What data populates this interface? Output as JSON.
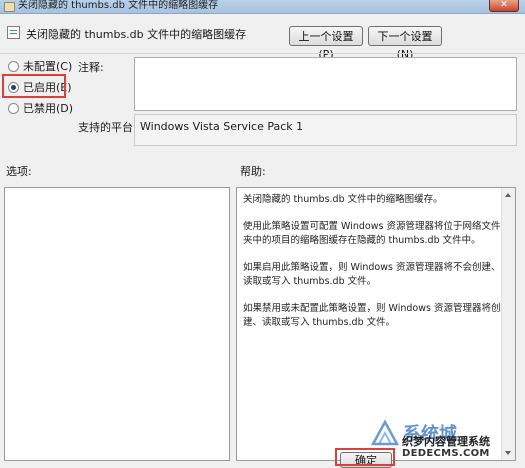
{
  "window": {
    "title": "关闭隐藏的 thumbs.db 文件中的缩略图缓存",
    "close_label": "✕"
  },
  "header": {
    "policy_name": "关闭隐藏的 thumbs.db 文件中的缩略图缓存",
    "prev_label": "上一个设置(P)",
    "next_label": "下一个设置(N)"
  },
  "state": {
    "options": [
      {
        "label": "未配置(C)",
        "selected": false
      },
      {
        "label": "已启用(E)",
        "selected": true
      },
      {
        "label": "已禁用(D)",
        "selected": false
      }
    ]
  },
  "comment": {
    "label": "注释:",
    "value": ""
  },
  "platform": {
    "label": "支持的平台:",
    "value": "Windows Vista Service Pack 1"
  },
  "options_pane": {
    "label": "选项:"
  },
  "help_pane": {
    "label": "帮助:",
    "paragraphs": [
      "关闭隐藏的 thumbs.db 文件中的缩略图缓存。",
      "使用此策略设置可配置 Windows 资源管理器将位于网络文件夹中的项目的缩略图缓存在隐藏的 thumbs.db 文件中。",
      "如果启用此策略设置，则 Windows 资源管理器将不会创建、读取或写入 thumbs.db 文件。",
      "如果禁用或未配置此策略设置，则 Windows 资源管理器将创建、读取或写入 thumbs.db 文件。"
    ]
  },
  "footer": {
    "ok_label": "确定"
  },
  "watermark": {
    "brand": "系统城",
    "subtitle": "织梦内容管理系统",
    "url": "DEDECMS.COM",
    "accent": "#2f6fc1"
  },
  "colors": {
    "highlight": "#d9423a",
    "titlebar": "#b9d1ea"
  }
}
